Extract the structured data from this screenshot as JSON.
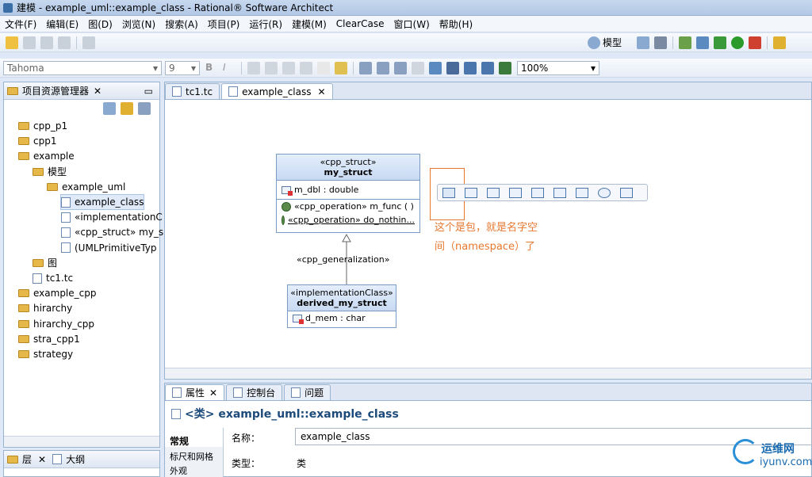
{
  "window": {
    "title": "建模 - example_uml::example_class - Rational® Software Architect"
  },
  "menu": [
    "文件(F)",
    "编辑(E)",
    "图(D)",
    "浏览(N)",
    "搜索(A)",
    "项目(P)",
    "运行(R)",
    "建模(M)",
    "ClearCase",
    "窗口(W)",
    "帮助(H)"
  ],
  "toolbar": {
    "model_label": "模型",
    "font_name": "Tahoma",
    "font_size": "9",
    "zoom": "100%"
  },
  "explorer": {
    "title": "项目资源管理器",
    "items": [
      {
        "label": "cpp_p1",
        "kind": "folder"
      },
      {
        "label": "cpp1",
        "kind": "folder"
      },
      {
        "label": "example",
        "kind": "folder"
      },
      {
        "label": "模型",
        "kind": "folder"
      },
      {
        "label": "example_uml",
        "kind": "folder"
      },
      {
        "label": "example_class",
        "kind": "file"
      },
      {
        "label": "«implementationC",
        "kind": "file"
      },
      {
        "label": "«cpp_struct» my_s",
        "kind": "file"
      },
      {
        "label": "(UMLPrimitiveTyp",
        "kind": "file"
      },
      {
        "label": "图",
        "kind": "folder"
      },
      {
        "label": "tc1.tc",
        "kind": "file"
      },
      {
        "label": "example_cpp",
        "kind": "folder"
      },
      {
        "label": "hirarchy",
        "kind": "folder"
      },
      {
        "label": "hirarchy_cpp",
        "kind": "folder"
      },
      {
        "label": "stra_cpp1",
        "kind": "folder"
      },
      {
        "label": "strategy",
        "kind": "folder"
      }
    ]
  },
  "bottom_left": {
    "tab1": "层",
    "tab2": "大纲"
  },
  "editor": {
    "tabs": [
      "tc1.tc",
      "example_class"
    ],
    "struct": {
      "stereotype": "«cpp_struct»",
      "name": "my_struct",
      "attr": "m_dbl : double",
      "op1": "«cpp_operation» m_func ( )",
      "op2": "«cpp_operation» do_nothin..."
    },
    "gen_label": "«cpp_generalization»",
    "derived": {
      "stereotype": "«implementationClass»",
      "name": "derived_my_struct",
      "attr": "d_mem : char"
    },
    "annotation_line1": "这个是包，就是名字空",
    "annotation_line2": "间（namespace）了"
  },
  "bottom": {
    "tabs": [
      "属性",
      "控制台",
      "问题"
    ],
    "heading": "<类> example_uml::example_class",
    "side_tabs": [
      "常规",
      "标尺和网格",
      "外观"
    ],
    "name_label": "名称：",
    "name_value": "example_class",
    "type_label": "类型：",
    "type_value": "类"
  },
  "watermark": {
    "site": "运维网",
    "url": "iyunv.com"
  }
}
